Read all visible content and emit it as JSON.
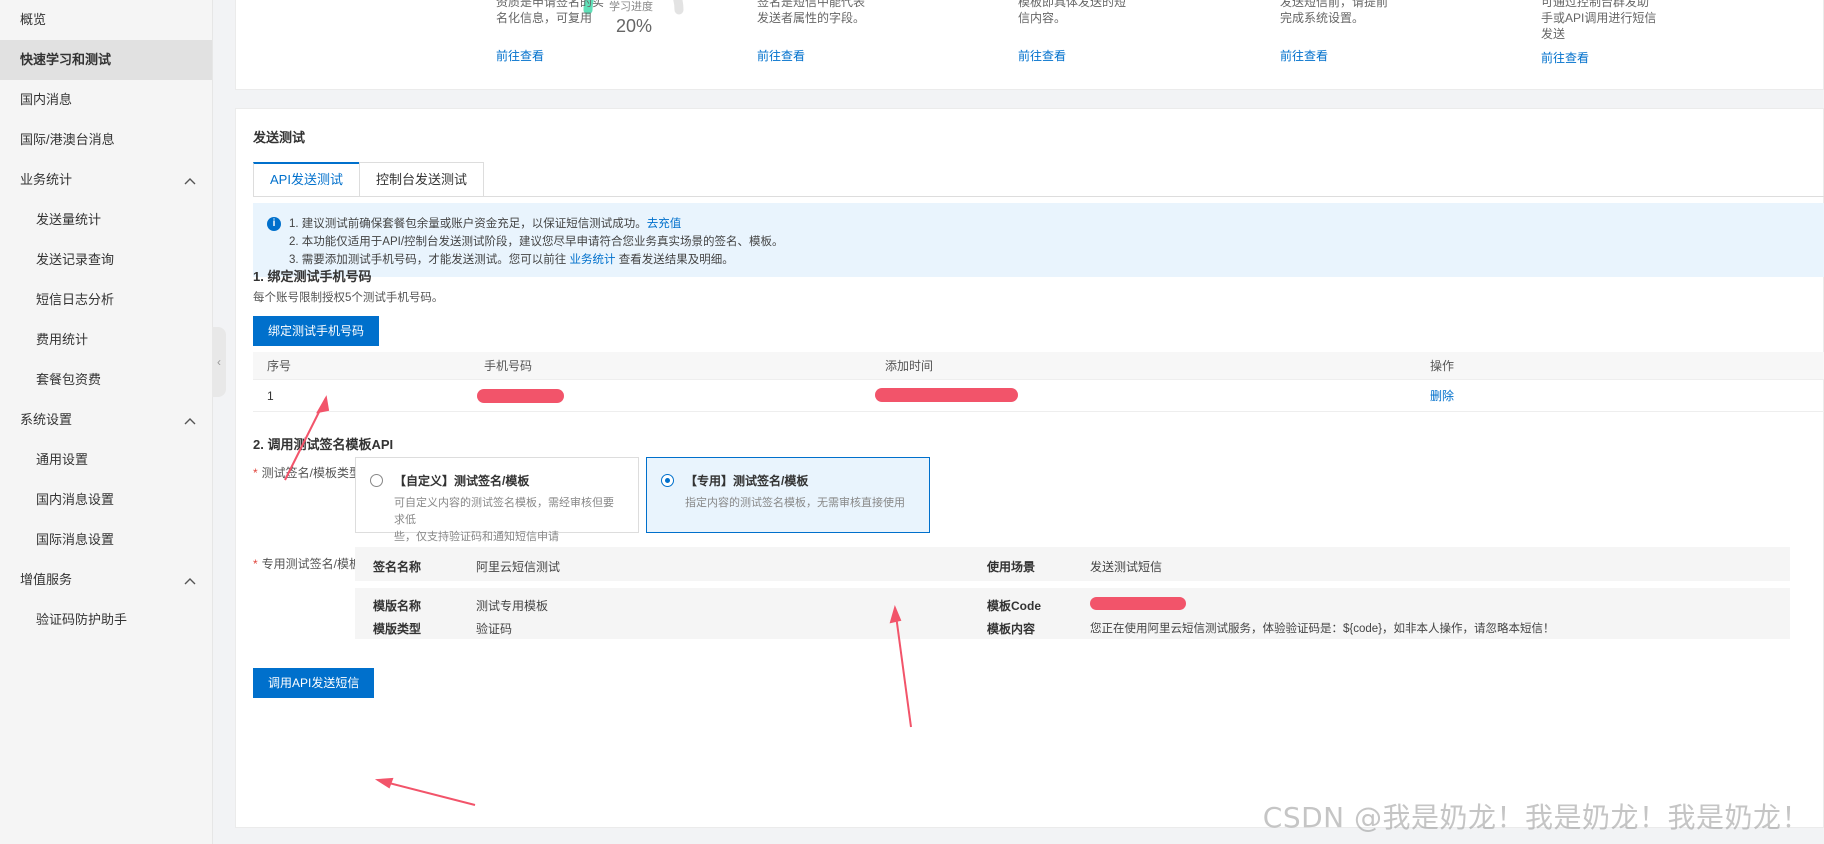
{
  "sidebar": {
    "items": [
      {
        "label": "概览",
        "type": "top"
      },
      {
        "label": "快速学习和测试",
        "type": "top",
        "active": true
      },
      {
        "label": "国内消息",
        "type": "top"
      },
      {
        "label": "国际/港澳台消息",
        "type": "top"
      },
      {
        "label": "业务统计",
        "type": "group"
      },
      {
        "label": "发送量统计",
        "type": "sub"
      },
      {
        "label": "发送记录查询",
        "type": "sub"
      },
      {
        "label": "短信日志分析",
        "type": "sub"
      },
      {
        "label": "费用统计",
        "type": "sub"
      },
      {
        "label": "套餐包资费",
        "type": "sub"
      },
      {
        "label": "系统设置",
        "type": "group"
      },
      {
        "label": "通用设置",
        "type": "sub"
      },
      {
        "label": "国内消息设置",
        "type": "sub"
      },
      {
        "label": "国际消息设置",
        "type": "sub"
      },
      {
        "label": "增值服务",
        "type": "group"
      },
      {
        "label": "验证码防护助手",
        "type": "sub"
      }
    ]
  },
  "top_card": {
    "progress_label": "学习进度",
    "progress_value": "20%",
    "progress_fraction": 0.2,
    "columns": [
      {
        "lines": [
          "资质是申请签名的实",
          "名化信息，可复用"
        ],
        "link": "前往查看"
      },
      {
        "lines": [
          "签名是短信中能代表",
          "发送者属性的字段。"
        ],
        "link": "前往查看"
      },
      {
        "lines": [
          "模板即具体发送的短",
          "信内容。"
        ],
        "link": "前往查看"
      },
      {
        "lines": [
          "发送短信前，请提前",
          "完成系统设置。"
        ],
        "link": "前往查看"
      },
      {
        "lines": [
          "可通过控制台群发助",
          "手或API调用进行短信",
          "发送"
        ],
        "link": "前往查看"
      }
    ]
  },
  "main": {
    "section_title": "发送测试",
    "tabs": [
      {
        "label": "API发送测试",
        "active": true
      },
      {
        "label": "控制台发送测试",
        "active": false
      }
    ],
    "notice": {
      "line1_text": "1. 建议测试前确保套餐包余量或账户资金充足，以保证短信测试成功。",
      "line1_link": "去充值",
      "line2_text": "2. 本功能仅适用于API/控制台发送测试阶段，建议您尽早申请符合您业务真实场景的签名、模板。",
      "line3_pre": "3. 需要添加测试手机号码，才能发送测试。您可以前往",
      "line3_link": "业务统计",
      "line3_post": "查看发送结果及明细。"
    },
    "step1": {
      "title": "1. 绑定测试手机号码",
      "desc": "每个账号限制授权5个测试手机号码。",
      "button": "绑定测试手机号码",
      "table": {
        "headers": [
          "序号",
          "手机号码",
          "添加时间",
          "操作"
        ],
        "rows": [
          {
            "index": "1",
            "action": "删除"
          }
        ]
      }
    },
    "step2": {
      "title": "2. 调用测试签名模板API",
      "type_label": "测试签名/模板类型",
      "options": [
        {
          "title": "【自定义】测试签名/模板",
          "desc1": "可自定义内容的测试签名模板，需经审核但要求低",
          "desc2": "些，仅支持验证码和通知短信申请",
          "selected": false
        },
        {
          "title": "【专用】测试签名/模板",
          "desc1": "指定内容的测试签名模板，无需审核直接使用",
          "desc2": "",
          "selected": true
        }
      ],
      "template_label": "专用测试签名/模板",
      "info": {
        "sign_name_label": "签名名称",
        "sign_name_value": "阿里云短信测试",
        "scene_label": "使用场景",
        "scene_value": "发送测试短信",
        "tpl_name_label": "模版名称",
        "tpl_name_value": "测试专用模板",
        "tpl_code_label": "模板Code",
        "tpl_type_label": "模版类型",
        "tpl_type_value": "验证码",
        "tpl_content_label": "模板内容",
        "tpl_content_value": "您正在使用阿里云短信测试服务，体验验证码是：${code}，如非本人操作，请忽略本短信！"
      },
      "send_button": "调用API发送短信"
    }
  },
  "watermark": "CSDN @我是奶龙！我是奶龙！我是奶龙！",
  "colors": {
    "accent": "#0070cc",
    "redact": "#f2546a",
    "gauge": "#5fe0b8"
  }
}
